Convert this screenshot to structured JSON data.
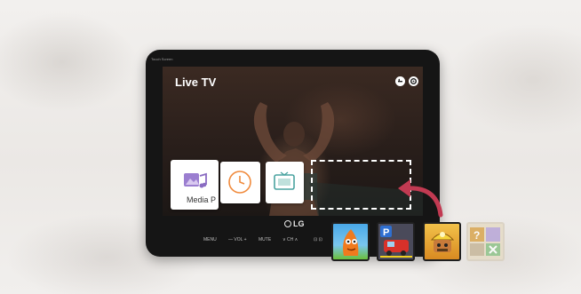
{
  "screen_caption": "Touch Screen",
  "live_tv": {
    "title": "Live TV"
  },
  "apps": [
    {
      "label": "Media P",
      "icon": "media-player-icon"
    },
    {
      "label": "",
      "icon": "clock-icon"
    },
    {
      "label": "",
      "icon": "tv-guide-icon"
    }
  ],
  "brand": "LG",
  "controls": {
    "menu": "MENU",
    "vol": "— VOL +",
    "mute": "MUTE",
    "ch": "∨ CH ∧",
    "extra": "⊡ ⊡"
  },
  "thumbnails": [
    {
      "icon": "orange-character-game-icon"
    },
    {
      "icon": "parking-game-icon"
    },
    {
      "icon": "miner-game-icon"
    },
    {
      "icon": "quiz-game-icon"
    }
  ],
  "colors": {
    "arrow": "#c23a52",
    "clock": "#f08a3c",
    "accent_teal": "#4aa3a0"
  }
}
